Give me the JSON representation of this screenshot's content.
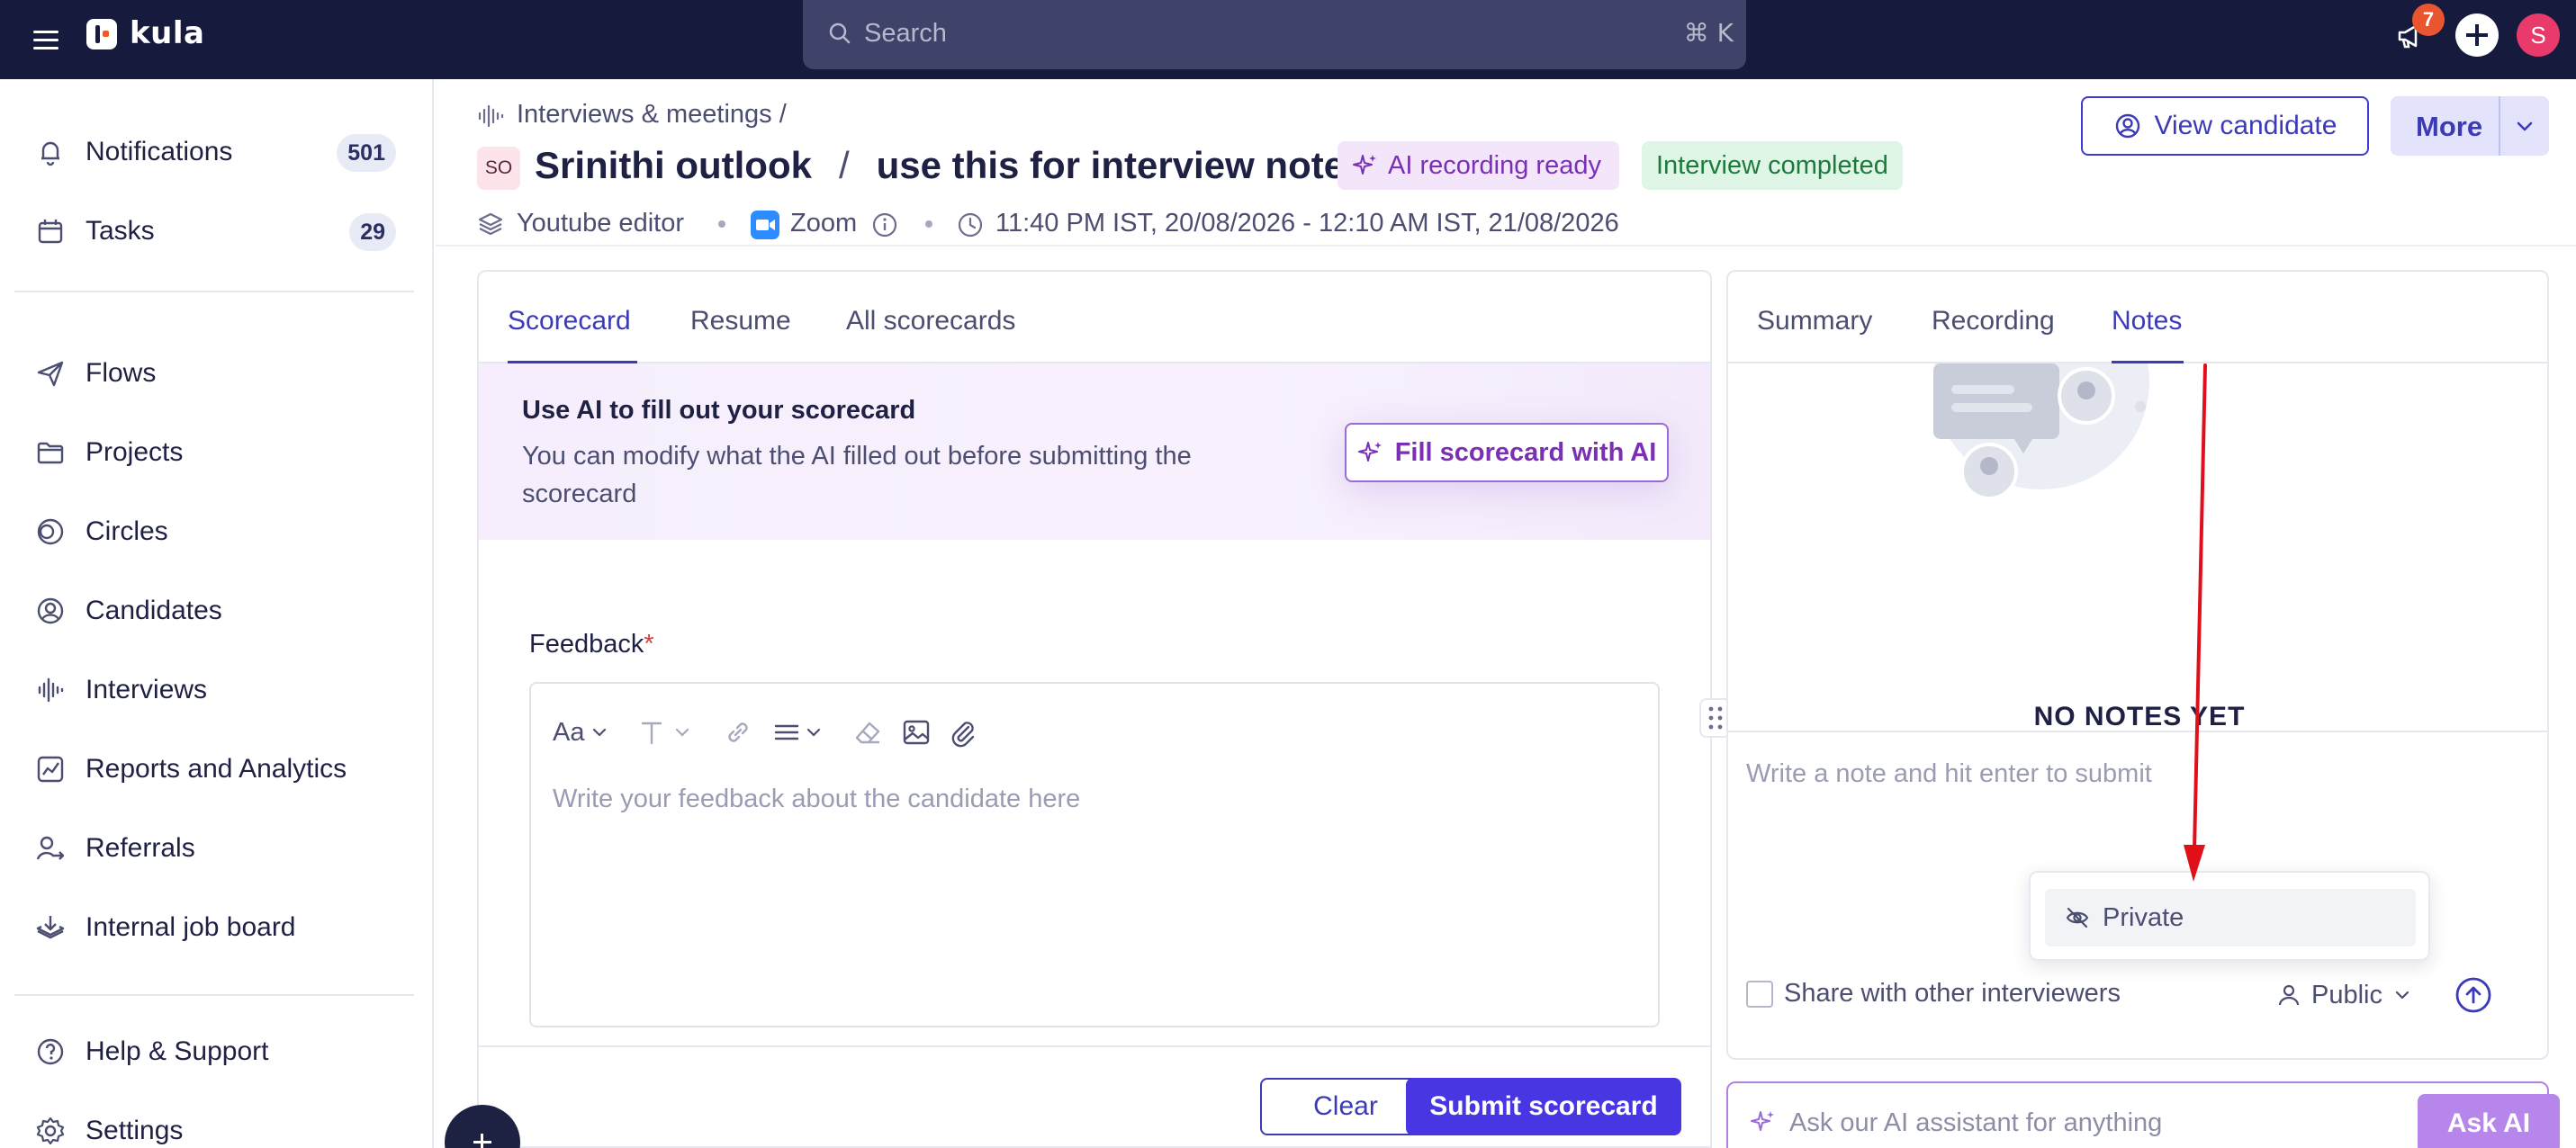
{
  "topbar": {
    "app_name": "kula",
    "search_placeholder": "Search",
    "search_shortcut": "⌘ K",
    "notification_count": "7",
    "user_initial": "S"
  },
  "sidebar": {
    "items": [
      {
        "label": "Notifications",
        "badge": "501",
        "icon": "bell-icon"
      },
      {
        "label": "Tasks",
        "badge": "29",
        "icon": "calendar-icon"
      },
      {
        "label": "Flows",
        "icon": "send-icon"
      },
      {
        "label": "Projects",
        "icon": "folder-icon"
      },
      {
        "label": "Circles",
        "icon": "circles-icon"
      },
      {
        "label": "Candidates",
        "icon": "user-circle-icon"
      },
      {
        "label": "Interviews",
        "icon": "waveform-icon"
      },
      {
        "label": "Reports and Analytics",
        "icon": "chart-icon"
      },
      {
        "label": "Referrals",
        "icon": "referral-icon"
      },
      {
        "label": "Internal job board",
        "icon": "job-board-icon"
      },
      {
        "label": "Help & Support",
        "icon": "help-icon"
      },
      {
        "label": "Settings",
        "icon": "gear-icon"
      }
    ]
  },
  "header": {
    "breadcrumb": "Interviews & meetings /",
    "avatar_initials": "SO",
    "candidate_name": "Srinithi outlook",
    "title_separator": "/",
    "meeting_title": "use this for interview notes",
    "badge_ai": "AI recording ready",
    "badge_status": "Interview completed",
    "view_candidate_label": "View candidate",
    "more_label": "More",
    "meta_role": "Youtube editor",
    "meta_platform": "Zoom",
    "meta_time": "11:40 PM IST, 20/08/2026 - 12:10 AM IST, 21/08/2026"
  },
  "left_panel": {
    "tabs": [
      "Scorecard",
      "Resume",
      "All scorecards"
    ],
    "active_tab": "Scorecard",
    "ai_banner_title": "Use AI to fill out your scorecard",
    "ai_banner_desc": "You can modify what the AI filled out before submitting the scorecard",
    "fill_ai_label": "Fill scorecard with AI",
    "feedback_label": "Feedback",
    "required_mark": "*",
    "toolbar_font_label": "Aa",
    "editor_placeholder": "Write your feedback about the candidate here",
    "clear_label": "Clear",
    "submit_label": "Submit scorecard"
  },
  "right_panel": {
    "tabs": [
      "Summary",
      "Recording",
      "Notes"
    ],
    "active_tab": "Notes",
    "empty_state": "NO NOTES YET",
    "note_placeholder": "Write a note and hit enter to submit",
    "visibility_option": "Private",
    "share_label": "Share with other interviewers",
    "visibility_selected": "Public",
    "ask_placeholder": "Ask our AI assistant for anything",
    "ask_label": "Ask AI"
  },
  "colors": {
    "topbar_bg": "#161a3d",
    "accent": "#3b3bb8",
    "primary_button": "#4836e3",
    "ai_purple": "#7a2fb5",
    "success_green": "#1f7a3d",
    "annotation_arrow": "#e0101a"
  }
}
